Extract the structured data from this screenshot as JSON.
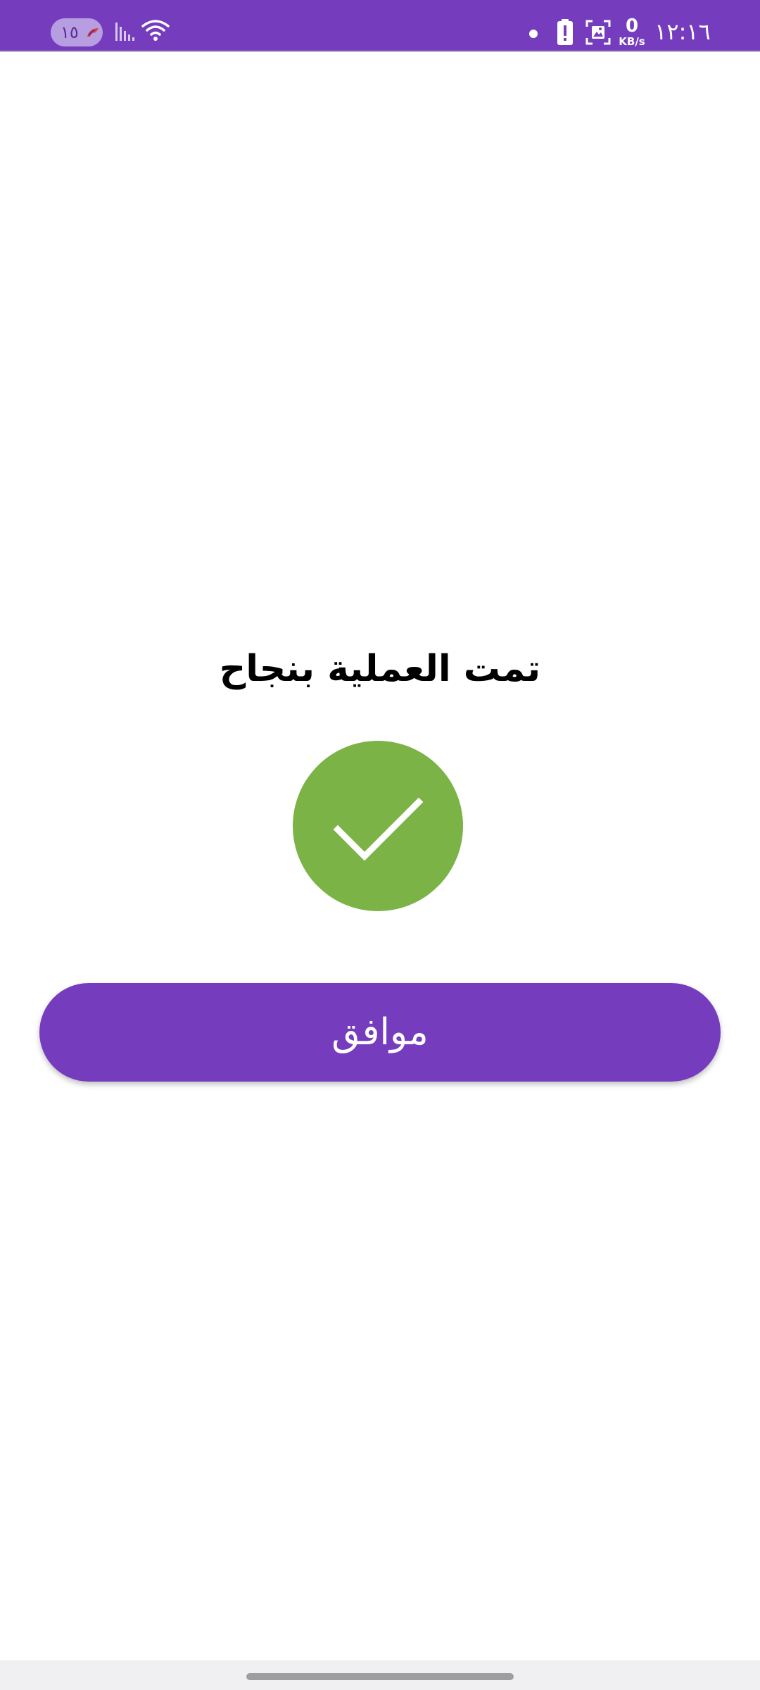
{
  "status_bar": {
    "time": "١٢:١٦",
    "net_speed_value": "0",
    "net_speed_unit": "KB/s",
    "pill_text": "١٥",
    "background_color": "#763cbe",
    "icons": [
      "wifi-icon",
      "signal-icon",
      "battery-alert-icon",
      "screenshot-icon",
      "dot-icon"
    ]
  },
  "dialog": {
    "title": "تمت العملية بنجاح",
    "status_icon": "check-circle-icon",
    "status_color": "#7cb347",
    "ok_button_label": "موافق",
    "button_color": "#763cbe"
  }
}
